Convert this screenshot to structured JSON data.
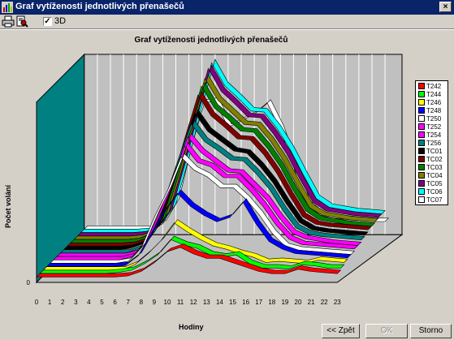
{
  "window": {
    "title": "Graf vytíženosti jednotlivých přenašečů",
    "close_glyph": "×"
  },
  "toolbar": {
    "print_icon": "printer-icon",
    "preview_icon": "print-preview-icon",
    "checkbox_3d_label": "3D",
    "checkbox_3d_checked": true
  },
  "buttons": {
    "back": "<< Zpět",
    "ok": "OK",
    "cancel": "Storno"
  },
  "chart_data": {
    "type": "line",
    "title": "Graf vytíženosti jednotlivých přenašečů",
    "xlabel": "Hodiny",
    "ylabel": "Počet volání",
    "view": "3D",
    "x": [
      0,
      1,
      2,
      3,
      4,
      5,
      6,
      7,
      8,
      9,
      10,
      11,
      12,
      13,
      14,
      15,
      16,
      17,
      18,
      19,
      20,
      21,
      22,
      23
    ],
    "y_tick_labels": [
      "0"
    ],
    "legend_position": "right",
    "series": [
      {
        "name": "T242",
        "color": "#ff0000",
        "values": [
          5,
          5,
          5,
          5,
          5,
          5,
          5,
          6,
          10,
          18,
          28,
          32,
          26,
          22,
          22,
          18,
          14,
          10,
          8,
          8,
          12,
          10,
          9,
          8
        ]
      },
      {
        "name": "T244",
        "color": "#00ff00",
        "values": [
          5,
          5,
          5,
          5,
          5,
          5,
          6,
          8,
          14,
          22,
          36,
          31,
          28,
          22,
          20,
          22,
          14,
          10,
          10,
          9,
          13,
          12,
          10,
          10
        ]
      },
      {
        "name": "T246",
        "color": "#ffff00",
        "values": [
          5,
          5,
          5,
          5,
          5,
          5,
          5,
          10,
          20,
          32,
          48,
          40,
          33,
          27,
          24,
          20,
          17,
          12,
          13,
          12,
          11,
          14,
          13,
          12
        ]
      },
      {
        "name": "T248",
        "color": "#0000ff",
        "values": [
          5,
          5,
          5,
          5,
          5,
          5,
          6,
          15,
          36,
          56,
          72,
          60,
          52,
          46,
          50,
          64,
          44,
          28,
          21,
          17,
          16,
          15,
          14,
          13
        ]
      },
      {
        "name": "T250",
        "color": "#ffffff",
        "values": [
          5,
          5,
          5,
          5,
          5,
          5,
          7,
          20,
          48,
          72,
          102,
          90,
          84,
          74,
          74,
          63,
          49,
          32,
          20,
          17,
          16,
          15,
          14,
          13
        ]
      },
      {
        "name": "T252",
        "color": "#ff00ff",
        "values": [
          5,
          5,
          5,
          5,
          5,
          5,
          8,
          20,
          46,
          75,
          109,
          94,
          90,
          80,
          80,
          68,
          54,
          37,
          24,
          19,
          18,
          17,
          16,
          15
        ]
      },
      {
        "name": "T254",
        "color": "#ff00ff",
        "values": [
          5,
          5,
          5,
          5,
          5,
          5,
          8,
          21,
          50,
          82,
          114,
          100,
          91,
          82,
          81,
          69,
          57,
          40,
          26,
          21,
          19,
          17,
          16,
          15
        ]
      },
      {
        "name": "T256",
        "color": "#008080",
        "values": [
          5,
          5,
          5,
          5,
          5,
          5,
          9,
          22,
          55,
          90,
          123,
          107,
          99,
          90,
          89,
          77,
          63,
          44,
          28,
          22,
          20,
          19,
          18,
          17
        ]
      },
      {
        "name": "TC01",
        "color": "#000000",
        "values": [
          5,
          5,
          5,
          5,
          5,
          6,
          10,
          24,
          58,
          95,
          130,
          113,
          104,
          95,
          93,
          81,
          66,
          47,
          30,
          23,
          21,
          20,
          19,
          18
        ]
      },
      {
        "name": "TC02",
        "color": "#800000",
        "values": [
          5,
          5,
          5,
          5,
          5,
          6,
          10,
          26,
          63,
          104,
          143,
          124,
          114,
          103,
          102,
          89,
          72,
          51,
          32,
          25,
          23,
          22,
          21,
          20
        ]
      },
      {
        "name": "TC03",
        "color": "#008000",
        "values": [
          5,
          5,
          5,
          5,
          5,
          6,
          10,
          26,
          64,
          108,
          148,
          128,
          118,
          107,
          106,
          92,
          75,
          53,
          34,
          26,
          24,
          22,
          21,
          20
        ]
      },
      {
        "name": "TC04",
        "color": "#808000",
        "values": [
          5,
          5,
          5,
          5,
          5,
          6,
          11,
          27,
          66,
          111,
          152,
          132,
          121,
          110,
          109,
          95,
          77,
          55,
          34,
          27,
          25,
          23,
          22,
          21
        ]
      },
      {
        "name": "TC05",
        "color": "#800080",
        "values": [
          5,
          5,
          5,
          5,
          5,
          6,
          11,
          28,
          69,
          115,
          158,
          137,
          126,
          114,
          113,
          98,
          80,
          57,
          36,
          28,
          26,
          24,
          23,
          22
        ]
      },
      {
        "name": "TC06",
        "color": "#00ffff",
        "values": [
          5,
          5,
          5,
          5,
          5,
          6,
          11,
          28,
          70,
          117,
          160,
          139,
          128,
          116,
          115,
          100,
          81,
          58,
          36,
          28,
          26,
          24,
          23,
          22
        ]
      },
      {
        "name": "TC07",
        "color": "#ffffff",
        "values": [
          5,
          5,
          5,
          5,
          5,
          5,
          10,
          30,
          80,
          120,
          122,
          98,
          104,
          110,
          120,
          96,
          62,
          28,
          18,
          15,
          14,
          13,
          12,
          12
        ]
      }
    ]
  }
}
